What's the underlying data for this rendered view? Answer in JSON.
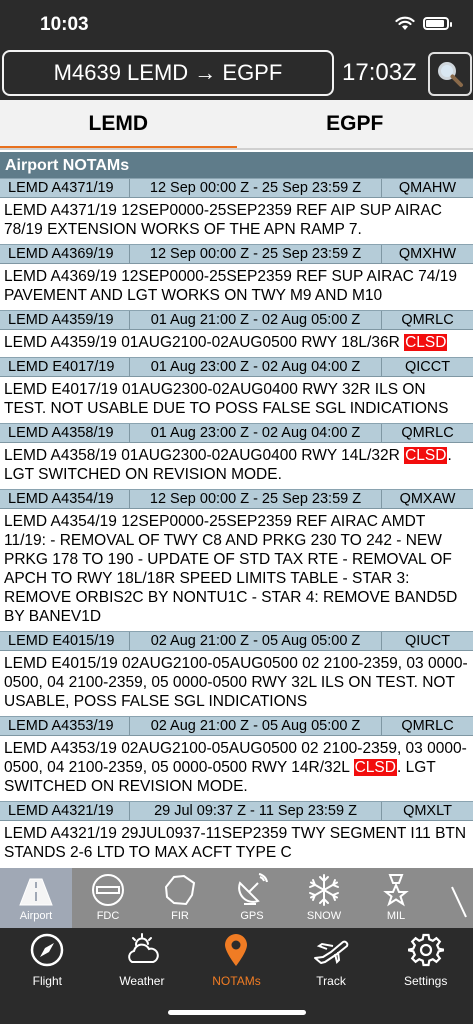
{
  "status": {
    "time": "10:03"
  },
  "header": {
    "route": "M4639 LEMD → EGPF",
    "clock": "17:03Z"
  },
  "tabs": [
    {
      "label": "LEMD",
      "active": true
    },
    {
      "label": "EGPF",
      "active": false
    }
  ],
  "section": {
    "title": "Airport NOTAMs"
  },
  "notams": [
    {
      "id": "LEMD A4371/19",
      "period": "12 Sep 00:00 Z - 25 Sep 23:59 Z",
      "code": "QMAHW",
      "parts": [
        "LEMD A4371/19 12SEP0000-25SEP2359 REF AIP SUP AIRAC 78/19  EXTENSION WORKS OF THE APN RAMP 7."
      ]
    },
    {
      "id": "LEMD A4369/19",
      "period": "12 Sep 00:00 Z - 25 Sep 23:59 Z",
      "code": "QMXHW",
      "parts": [
        "LEMD A4369/19 12SEP0000-25SEP2359 REF SUP AIRAC 74/19  PAVEMENT AND LGT WORKS ON TWY M9 AND M10"
      ]
    },
    {
      "id": "LEMD A4359/19",
      "period": "01 Aug 21:00 Z - 02 Aug 05:00 Z",
      "code": "QMRLC",
      "parts": [
        "LEMD A4359/19 01AUG2100-02AUG0500 RWY 18L/36R ",
        "CLSD",
        ""
      ]
    },
    {
      "id": "LEMD E4017/19",
      "period": "01 Aug 23:00 Z - 02 Aug 04:00 Z",
      "code": "QICCT",
      "parts": [
        "LEMD E4017/19 01AUG2300-02AUG0400 RWY 32R ILS ON TEST. NOT USABLE DUE TO POSS FALSE SGL INDICATIONS"
      ]
    },
    {
      "id": "LEMD A4358/19",
      "period": "01 Aug 23:00 Z - 02 Aug 04:00 Z",
      "code": "QMRLC",
      "parts": [
        "LEMD A4358/19 01AUG2300-02AUG0400 RWY 14L/32R ",
        "CLSD",
        ". LGT SWITCHED ON REVISION MODE."
      ]
    },
    {
      "id": "LEMD A4354/19",
      "period": "12 Sep 00:00 Z - 25 Sep 23:59 Z",
      "code": "QMXAW",
      "parts": [
        "LEMD A4354/19 12SEP0000-25SEP2359 REF AIRAC AMDT 11/19: - REMOVAL OF TWY C8 AND PRKG 230 TO 242  - NEW PRKG 178 TO 190  - UPDATE OF STD TAX RTE - REMOVAL OF APCH TO RWY 18L/18R SPEED LIMITS TABLE - STAR 3: REMOVE ORBIS2C BY NONTU1C - STAR 4: REMOVE BAND5D BY BANEV1D"
      ]
    },
    {
      "id": "LEMD E4015/19",
      "period": "02 Aug 21:00 Z - 05 Aug 05:00 Z",
      "code": "QIUCT",
      "parts": [
        "LEMD E4015/19 02AUG2100-05AUG0500 02 2100-2359, 03 0000-0500, 04 2100-2359, 05 0000-0500 RWY 32L ILS ON TEST. NOT USABLE, POSS FALSE SGL INDICATIONS"
      ]
    },
    {
      "id": "LEMD A4353/19",
      "period": "02 Aug 21:00 Z - 05 Aug 05:00 Z",
      "code": "QMRLC",
      "parts": [
        "LEMD A4353/19 02AUG2100-05AUG0500 02 2100-2359, 03 0000-0500, 04 2100-2359, 05 0000-0500 RWY 14R/32L ",
        "CLSD",
        ". LGT SWITCHED ON REVISION MODE."
      ]
    },
    {
      "id": "LEMD A4321/19",
      "period": "29 Jul 09:37 Z - 11 Sep 23:59 Z",
      "code": "QMXLT",
      "parts": [
        "LEMD A4321/19 29JUL0937-11SEP2359 TWY SEGMENT I11 BTN STANDS 2-6 LTD TO MAX ACFT TYPE C"
      ]
    }
  ],
  "categories": [
    {
      "label": "Airport",
      "icon": "runway-icon",
      "active": true
    },
    {
      "label": "FDC",
      "icon": "no-entry-icon",
      "active": false
    },
    {
      "label": "FIR",
      "icon": "fir-region-icon",
      "active": false
    },
    {
      "label": "GPS",
      "icon": "satellite-dish-icon",
      "active": false
    },
    {
      "label": "SNOW",
      "icon": "snowflake-icon",
      "active": false
    },
    {
      "label": "MIL",
      "icon": "military-star-icon",
      "active": false
    }
  ],
  "tabbar": [
    {
      "label": "Flight",
      "icon": "compass-icon",
      "active": false
    },
    {
      "label": "Weather",
      "icon": "weather-icon",
      "active": false
    },
    {
      "label": "NOTAMs",
      "icon": "location-pin-icon",
      "active": true
    },
    {
      "label": "Track",
      "icon": "airplane-icon",
      "active": false
    },
    {
      "label": "Settings",
      "icon": "gear-icon",
      "active": false
    }
  ],
  "colors": {
    "accent": "#f07c24",
    "header_bg": "#2b2b2b",
    "section_bg": "#5f7c8a",
    "notam_head_bg": "#b5ccd8",
    "clsd": "#f20d0d"
  }
}
